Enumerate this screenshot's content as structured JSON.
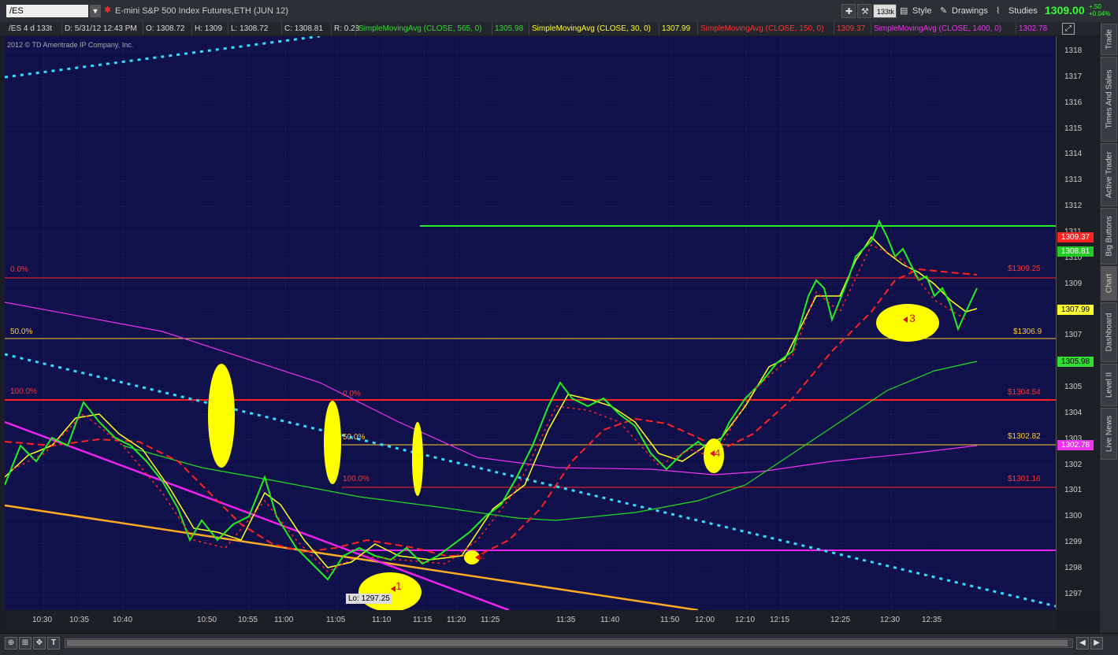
{
  "toolbar": {
    "symbol": "/ES",
    "description": "E-mini S&P 500 Index Futures,ETH (JUN 12)",
    "tick_label": "133tk",
    "style": "Style",
    "drawings": "Drawings",
    "studies": "Studies",
    "last_price": "1309.00",
    "change_abs": "+.50",
    "change_pct": "+0.04%"
  },
  "studybar": {
    "symbol_period": "/ES 4 d 133t",
    "date": "D: 5/31/12 12:43 PM",
    "open": "O: 1308.72",
    "high": "H: 1309",
    "low": "L: 1308.72",
    "close": "C: 1308.81",
    "range": "R: 0.28",
    "sma1": "SimpleMovingAvg (CLOSE, 565, 0)",
    "sma1_val": "1305.98",
    "sma2": "SimpleMovingAvg (CLOSE, 30, 0)",
    "sma2_val": "1307.99",
    "sma3": "SimpleMovingAvg (CLOSE, 150, 0)",
    "sma3_val": "1309.37",
    "sma4": "SimpleMovingAvg (CLOSE, 1400, 0)",
    "sma4_val": "1302.78"
  },
  "copyright": "2012 © TD Ameritrade IP Company, Inc.",
  "colors": {
    "sma1": "#33dd33",
    "sma2": "#ffff33",
    "sma3": "#ff2222",
    "sma4": "#ee33ee",
    "plot_bg": "#10114a"
  },
  "y_axis_labels": [
    "1318",
    "1317",
    "1316",
    "1315",
    "1314",
    "1313",
    "1312",
    "1311",
    "1310",
    "1309",
    "1308",
    "1307",
    "1306",
    "1305",
    "1304",
    "1303",
    "1302",
    "1301",
    "1300",
    "1299",
    "1298",
    "1297"
  ],
  "axis_price_boxes": [
    {
      "label": "1309.37",
      "color": "#ff2222",
      "text": "#fff"
    },
    {
      "label": "1308.81",
      "color": "#22cc22",
      "text": "#fff"
    },
    {
      "label": "1307.99",
      "color": "#ffff33",
      "text": "#000"
    },
    {
      "label": "1305.98",
      "color": "#33dd33",
      "text": "#000"
    },
    {
      "label": "1302.78",
      "color": "#ee33ee",
      "text": "#fff"
    }
  ],
  "time_labels": [
    "10:30",
    "10:35",
    "10:40",
    "10:50",
    "10:55",
    "11:00",
    "11:05",
    "11:10",
    "11:15",
    "11:20",
    "11:25",
    "11:35",
    "11:40",
    "11:50",
    "12:00",
    "12:10",
    "12:15",
    "12:25",
    "12:30",
    "12:35"
  ],
  "fib_labels": {
    "a_0": "0.0%",
    "a_50": "50.0%",
    "a_100": "100.0%",
    "b_0": "0.0%",
    "b_50": "50.0%",
    "b_100": "100.0%",
    "p_1309_25": "$1309.25",
    "p_1306_9": "$1306.9",
    "p_1304_54": "$1304.54",
    "p_1302_82": "$1302.82",
    "p_1301_16": "$1301.16"
  },
  "low_label": "Lo: 1297.25",
  "markers": [
    "1",
    "2",
    "3",
    "4"
  ],
  "side_tabs": [
    "Trade",
    "Times And Sales",
    "Active Trader",
    "Big Buttons",
    "Chart",
    "Dashboard",
    "Level II",
    "Live News"
  ]
}
